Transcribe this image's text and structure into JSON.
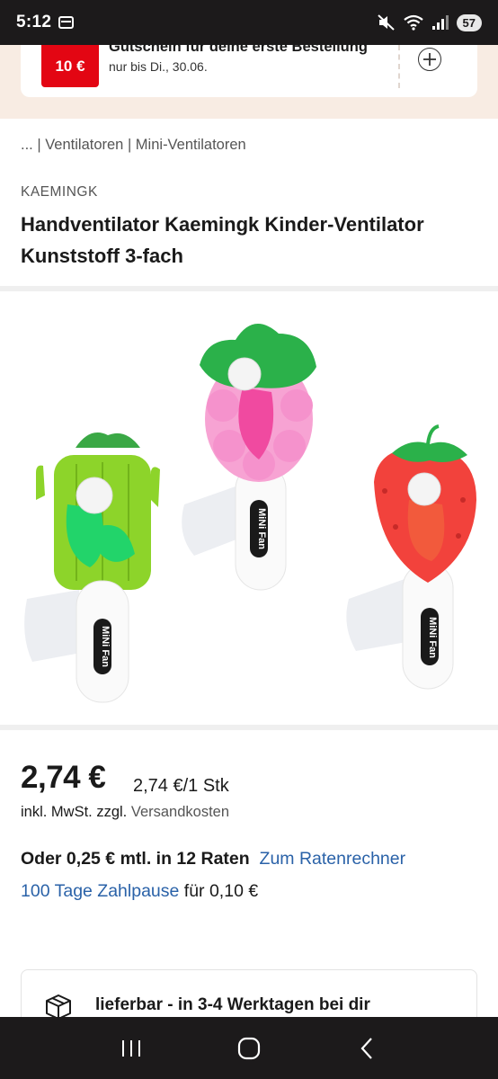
{
  "status_bar": {
    "time": "5:12",
    "battery": "57"
  },
  "voucher": {
    "badge": "10 €",
    "title": "Gutschein für deine erste Bestellung",
    "subtitle": "nur bis Di., 30.06."
  },
  "breadcrumb": "... | Ventilatoren | Mini-Ventilatoren",
  "product": {
    "brand": "KAEMINGK",
    "title": "Handventilator Kaemingk Kinder-Ventilator Kunststoff 3-fach",
    "fan_label": "MiNi Fan"
  },
  "price": {
    "main": "2,74 €",
    "unit": "2,74 €/1 Stk",
    "tax_prefix": "inkl. MwSt. zzgl. ",
    "tax_link": "Versandkosten",
    "installment_text": "Oder 0,25 € mtl. in 12 Raten",
    "installment_link": "Zum Ratenrechner",
    "pause_link": "100 Tage Zahlpause",
    "pause_suffix": " für 0,10 €"
  },
  "delivery": {
    "text": "lieferbar - in 3-4 Werktagen bei dir"
  },
  "colors": {
    "accent_red": "#e30613",
    "link_blue": "#2a62a8",
    "banner_bg": "#f8ece3"
  }
}
